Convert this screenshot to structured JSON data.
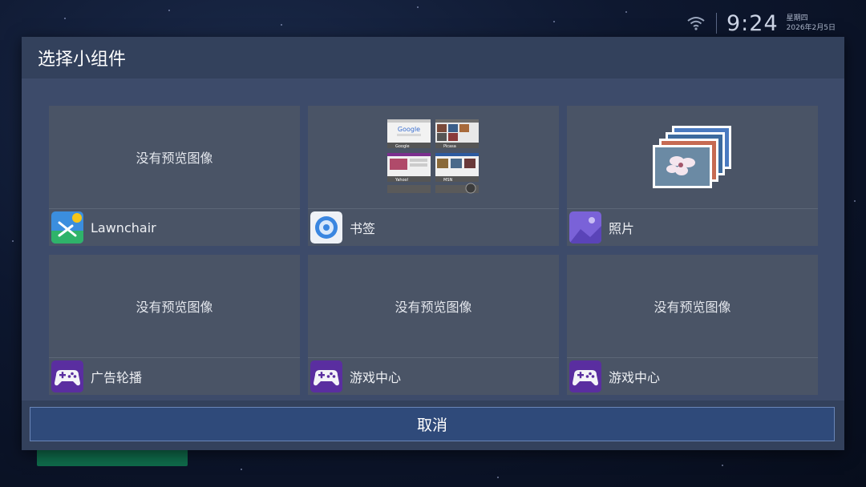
{
  "status": {
    "time": "9:24",
    "weekday": "星期四",
    "date": "2026年2月5日"
  },
  "dialog": {
    "title": "选择小组件",
    "cancel_label": "取消"
  },
  "widgets": [
    {
      "preview_text": "没有预览图像",
      "label": "Lawnchair",
      "icon": "lawnchair-icon"
    },
    {
      "preview_text": "",
      "label": "书签",
      "icon": "bookmarks-icon"
    },
    {
      "preview_text": "",
      "label": "照片",
      "icon": "photos-icon"
    },
    {
      "preview_text": "没有预览图像",
      "label": "广告轮播",
      "icon": "gamepad-icon"
    },
    {
      "preview_text": "没有预览图像",
      "label": "游戏中心",
      "icon": "gamepad-icon"
    },
    {
      "preview_text": "没有预览图像",
      "label": "游戏中心",
      "icon": "gamepad-icon"
    }
  ],
  "bookmark_thumbs": [
    "Google",
    "Picasa",
    "Yahoo!",
    "MSN"
  ],
  "colors": {
    "dialog_bg": "#3a4866",
    "card_bg": "#4a5466",
    "cancel_bg": "#2f4a7a",
    "gamepad_purple": "#5a2ea0",
    "photos_purple": "#7a62d8"
  }
}
